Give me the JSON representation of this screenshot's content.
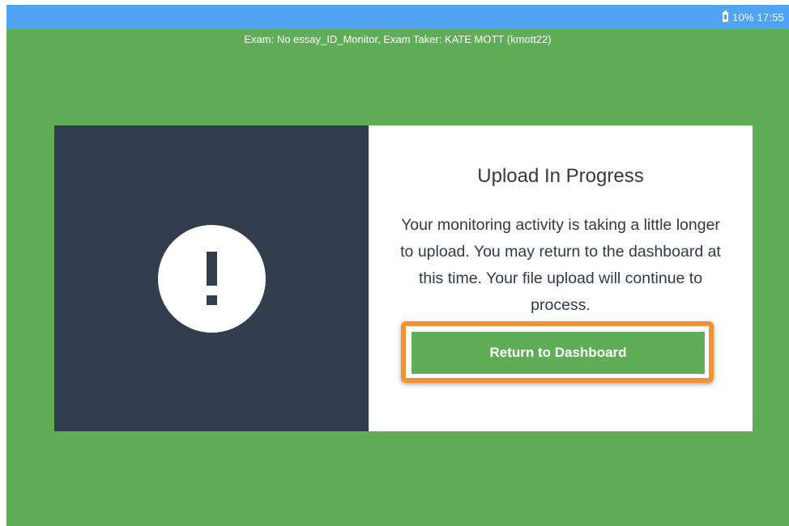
{
  "status_bar": {
    "battery_icon": "battery-charging-icon",
    "battery": "10%",
    "time": "17:55",
    "background_color": "#4fa3f0"
  },
  "exam_header": "Exam: No essay_ID_Monitor, Exam Taker: KATE MOTT (kmott22)",
  "dialog": {
    "icon": "exclamation-icon",
    "title": "Upload In Progress",
    "message": "Your monitoring activity is taking a little longer to upload. You may return to the dashboard at this time. Your file upload will continue to process.",
    "button_label": "Return to Dashboard"
  },
  "colors": {
    "background": "#5fad56",
    "panel_dark": "#323e4e",
    "button": "#5fad56",
    "highlight": "#f39234"
  }
}
